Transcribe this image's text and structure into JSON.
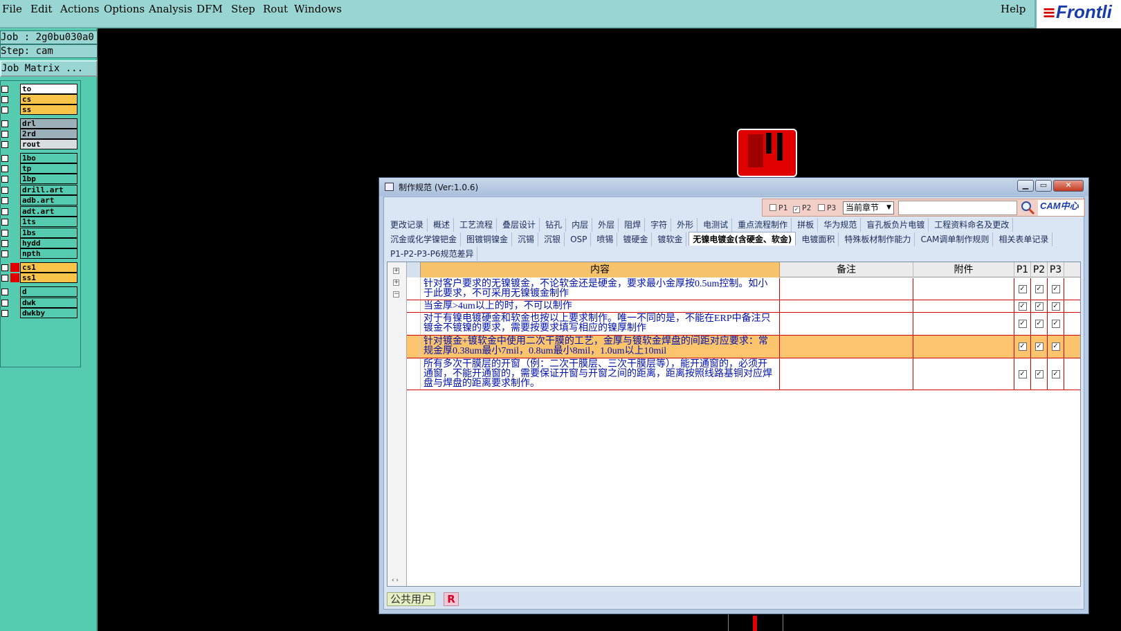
{
  "menubar": {
    "items": [
      "File",
      "Edit",
      "Actions",
      "Options",
      "Analysis",
      "DFM",
      "Step",
      "Rout",
      "Windows"
    ],
    "help": "Help",
    "brand": "Frontli"
  },
  "left": {
    "job": "Job : 2g0bu030a0",
    "step": "Step: cam",
    "job_matrix": "Job Matrix ...",
    "layers": [
      {
        "name": "to",
        "color": "#ffffff"
      },
      {
        "name": "cs",
        "color": "#f8c44a"
      },
      {
        "name": "ss",
        "color": "#f8c44a"
      },
      {
        "name": "drl",
        "color": "#9bb0b8"
      },
      {
        "name": "2rd",
        "color": "#9bb0b8"
      },
      {
        "name": "rout",
        "color": "#d8dede"
      },
      {
        "name": "1bo",
        "color": "#55ccb0"
      },
      {
        "name": "tp",
        "color": "#55ccb0"
      },
      {
        "name": "1bp",
        "color": "#55ccb0"
      },
      {
        "name": "drill.art",
        "color": "#55ccb0"
      },
      {
        "name": "adb.art",
        "color": "#55ccb0"
      },
      {
        "name": "adt.art",
        "color": "#55ccb0"
      },
      {
        "name": "1ts",
        "color": "#55ccb0"
      },
      {
        "name": "1bs",
        "color": "#55ccb0"
      },
      {
        "name": "hydd",
        "color": "#55ccb0"
      },
      {
        "name": "npth",
        "color": "#55ccb0"
      },
      {
        "name": "cs1",
        "color": "#f8c44a"
      },
      {
        "name": "ss1",
        "color": "#f8c44a"
      },
      {
        "name": "d",
        "color": "#55ccb0"
      },
      {
        "name": "dwk",
        "color": "#55ccb0"
      },
      {
        "name": "dwkby",
        "color": "#55ccb0"
      }
    ]
  },
  "dialog": {
    "title": "制作规范 (Ver:1.0.6)",
    "buttons": {
      "minimize": "▁",
      "maximize": "▭",
      "close": "✕"
    },
    "filters": {
      "p1": "P1",
      "p2": "P2",
      "p3": "P3",
      "p1_checked": false,
      "p2_checked": true,
      "p3_checked": false
    },
    "chapter_select": "当前章节",
    "search_value": "",
    "cam_logo": "CAM中心",
    "tabs_row1": [
      "更改记录",
      "概述",
      "工艺流程",
      "叠层设计",
      "钻孔",
      "内层",
      "外层",
      "阻焊",
      "字符",
      "外形",
      "电测试",
      "重点流程制作",
      "拼板",
      "华为规范",
      "盲孔板负片电镀",
      "工程资料命名及更改"
    ],
    "tabs_row2": [
      "沉金或化学镍钯金",
      "图镀铜镍金",
      "沉锡",
      "沉银",
      "OSP",
      "喷锡",
      "镀硬金",
      "镀软金",
      "无镍电镀金(含硬金、软金)",
      "电镀面积",
      "特殊板材制作能力",
      "CAM调单制作规则",
      "相关表单记录"
    ],
    "tabs_row3": [
      "P1-P2-P3-P6规范差异"
    ],
    "active_tab": "无镍电镀金(含硬金、软金)",
    "columns": {
      "content": "内容",
      "remark": "备注",
      "attachment": "附件",
      "p1": "P1",
      "p2": "P2",
      "p3": "P3"
    },
    "rows": [
      {
        "content": "针对客户要求的无镍镀金，不论软金还是硬金，要求最小金厚按0.5um控制。如小于此要求，不可采用无镍镀金制作",
        "remark": "",
        "attachment": "",
        "p1": true,
        "p2": true,
        "p3": true
      },
      {
        "content": "当金厚>4um以上的时，不可以制作",
        "remark": "",
        "attachment": "",
        "p1": true,
        "p2": true,
        "p3": true
      },
      {
        "content": "对于有镍电镀硬金和软金也按以上要求制作。唯一不同的是，不能在ERP中备注只镀金不镀镍的要求，需要按要求填写相应的镍厚制作",
        "remark": "",
        "attachment": "",
        "p1": true,
        "p2": true,
        "p3": true
      },
      {
        "content": "针对镀金+镀软金中使用二次干膜的工艺，金厚与镀软金焊盘的间距对应要求：常规金厚0.38um最小7mil，0.8um最小8mil，1.0um以上10mil",
        "remark": "",
        "attachment": "",
        "p1": true,
        "p2": true,
        "p3": true
      },
      {
        "content": "所有多次干膜层的开窗（例：二次干膜层、三次干膜层等），能开通窗的，必须开通窗，不能开通窗的，需要保证开窗与开窗之间的距离，距离按照线路基铜对应焊盘与焊盘的距离要求制作。",
        "remark": "",
        "attachment": "",
        "p1": true,
        "p2": true,
        "p3": true
      }
    ],
    "status_user": "公共用户",
    "status_role": "R"
  }
}
